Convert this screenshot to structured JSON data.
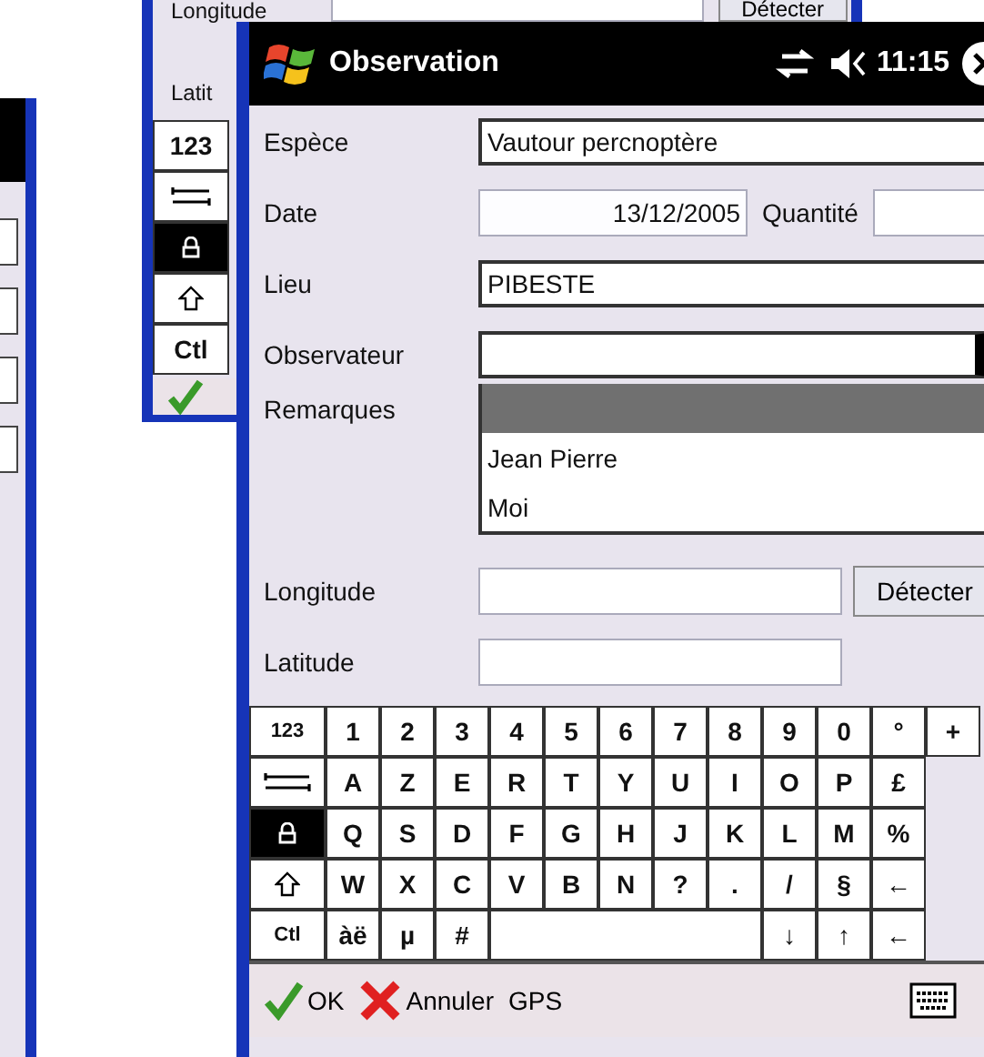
{
  "back_window": {
    "longitude_label": "Longitude",
    "latitude_label": "Latit",
    "detect_button": "Détecter",
    "keys": [
      {
        "kind": "char",
        "label": "123"
      },
      {
        "kind": "tab"
      },
      {
        "kind": "caps",
        "on": true
      },
      {
        "kind": "shift"
      },
      {
        "kind": "char",
        "label": "Ctl"
      }
    ]
  },
  "window": {
    "title": "Observation",
    "time": "11:15"
  },
  "form": {
    "species_label": "Espèce",
    "species": "Vautour percnoptère",
    "date_label": "Date",
    "date": "13/12/2005",
    "quantity_label": "Quantité",
    "place_label": "Lieu",
    "place": "PIBESTE",
    "observer_label": "Observateur",
    "observer_expanded": true,
    "observer_options": [
      {
        "selected": true
      },
      {
        "label": "Jean Pierre",
        "selected": false
      },
      {
        "label": "Moi",
        "selected": false
      }
    ],
    "remarks_label": "Remarques",
    "longitude_label": "Longitude",
    "detect_button": "Détecter",
    "latitude_label": "Latitude"
  },
  "keyboard": {
    "rows": [
      [
        {
          "kind": "char",
          "label": "123"
        },
        {
          "kind": "char",
          "label": "1"
        },
        {
          "kind": "char",
          "label": "2"
        },
        {
          "kind": "char",
          "label": "3"
        },
        {
          "kind": "char",
          "label": "4"
        },
        {
          "kind": "char",
          "label": "5"
        },
        {
          "kind": "char",
          "label": "6"
        },
        {
          "kind": "char",
          "label": "7"
        },
        {
          "kind": "char",
          "label": "8"
        },
        {
          "kind": "char",
          "label": "9"
        },
        {
          "kind": "char",
          "label": "0"
        },
        {
          "kind": "char",
          "label": "°"
        },
        {
          "kind": "char",
          "label": "+"
        }
      ],
      [
        {
          "kind": "tab"
        },
        {
          "kind": "char",
          "label": "A"
        },
        {
          "kind": "char",
          "label": "Z"
        },
        {
          "kind": "char",
          "label": "E"
        },
        {
          "kind": "char",
          "label": "R"
        },
        {
          "kind": "char",
          "label": "T"
        },
        {
          "kind": "char",
          "label": "Y"
        },
        {
          "kind": "char",
          "label": "U"
        },
        {
          "kind": "char",
          "label": "I"
        },
        {
          "kind": "char",
          "label": "O"
        },
        {
          "kind": "char",
          "label": "P"
        },
        {
          "kind": "char",
          "label": "£"
        }
      ],
      [
        {
          "kind": "caps",
          "on": true
        },
        {
          "kind": "char",
          "label": "Q"
        },
        {
          "kind": "char",
          "label": "S"
        },
        {
          "kind": "char",
          "label": "D"
        },
        {
          "kind": "char",
          "label": "F"
        },
        {
          "kind": "char",
          "label": "G"
        },
        {
          "kind": "char",
          "label": "H"
        },
        {
          "kind": "char",
          "label": "J"
        },
        {
          "kind": "char",
          "label": "K"
        },
        {
          "kind": "char",
          "label": "L"
        },
        {
          "kind": "char",
          "label": "M"
        },
        {
          "kind": "char",
          "label": "%"
        }
      ],
      [
        {
          "kind": "shift"
        },
        {
          "kind": "char",
          "label": "W"
        },
        {
          "kind": "char",
          "label": "X"
        },
        {
          "kind": "char",
          "label": "C"
        },
        {
          "kind": "char",
          "label": "V"
        },
        {
          "kind": "char",
          "label": "B"
        },
        {
          "kind": "char",
          "label": "N"
        },
        {
          "kind": "char",
          "label": "?"
        },
        {
          "kind": "char",
          "label": "."
        },
        {
          "kind": "char",
          "label": "/"
        },
        {
          "kind": "char",
          "label": "§"
        },
        {
          "kind": "char",
          "label": "←"
        }
      ]
    ],
    "bottom_row": {
      "keys": [
        {
          "kind": "char",
          "label": "Ctl"
        },
        {
          "kind": "char",
          "label": "àë"
        },
        {
          "kind": "char",
          "label": "µ"
        },
        {
          "kind": "char",
          "label": "#"
        }
      ],
      "arrow_keys": [
        "↓",
        "↑",
        "←"
      ]
    }
  },
  "menu_bar": {
    "ok": "OK",
    "cancel": "Annuler",
    "gps": "GPS"
  }
}
